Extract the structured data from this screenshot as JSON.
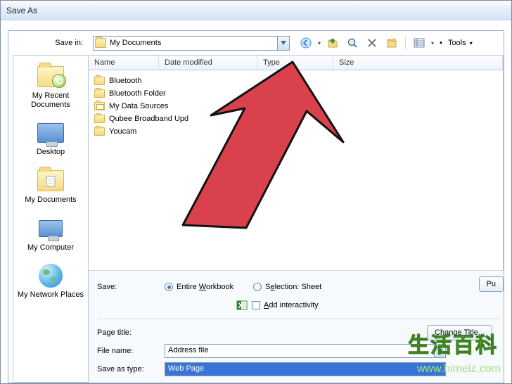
{
  "window": {
    "title": "Save As"
  },
  "toolbar": {
    "save_in_label": "Save in:",
    "save_in_value": "My Documents",
    "tools_label": "Tools",
    "tools_dd": "▾",
    "tools_bullet": "▪"
  },
  "places": [
    {
      "label": "My Recent Documents"
    },
    {
      "label": "Desktop"
    },
    {
      "label": "My Documents"
    },
    {
      "label": "My Computer"
    },
    {
      "label": "My Network Places"
    }
  ],
  "columns": {
    "name": "Name",
    "date": "Date modified",
    "type": "Type",
    "size": "Size"
  },
  "files": [
    {
      "name": "Bluetooth",
      "kind": "folder"
    },
    {
      "name": "Bluetooth Folder",
      "kind": "folder"
    },
    {
      "name": "My Data Sources",
      "kind": "special"
    },
    {
      "name": "Qubee Broadband Upd",
      "kind": "folder"
    },
    {
      "name": "Youcam",
      "kind": "folder"
    }
  ],
  "save_opts": {
    "label": "Save:",
    "entire_pre": "Entire ",
    "entire_mn": "W",
    "entire_post": "orkbook",
    "sel_pre": "S",
    "sel_mn": "e",
    "sel_post": "lection: Sheet",
    "publish_btn": "Pu",
    "add_pre": "",
    "add_mn": "A",
    "add_post": "dd interactivity"
  },
  "page_title": {
    "label": "Page title:",
    "btn_pre": "",
    "btn_mn": "C",
    "btn_post": "hange Title..."
  },
  "filename": {
    "label": "File name:",
    "value": "Address file"
  },
  "saveas": {
    "label": "Save as type:",
    "value": "Web Page"
  },
  "watermark": {
    "line1": "生活百科",
    "line2": "www.bimeiz.com"
  }
}
